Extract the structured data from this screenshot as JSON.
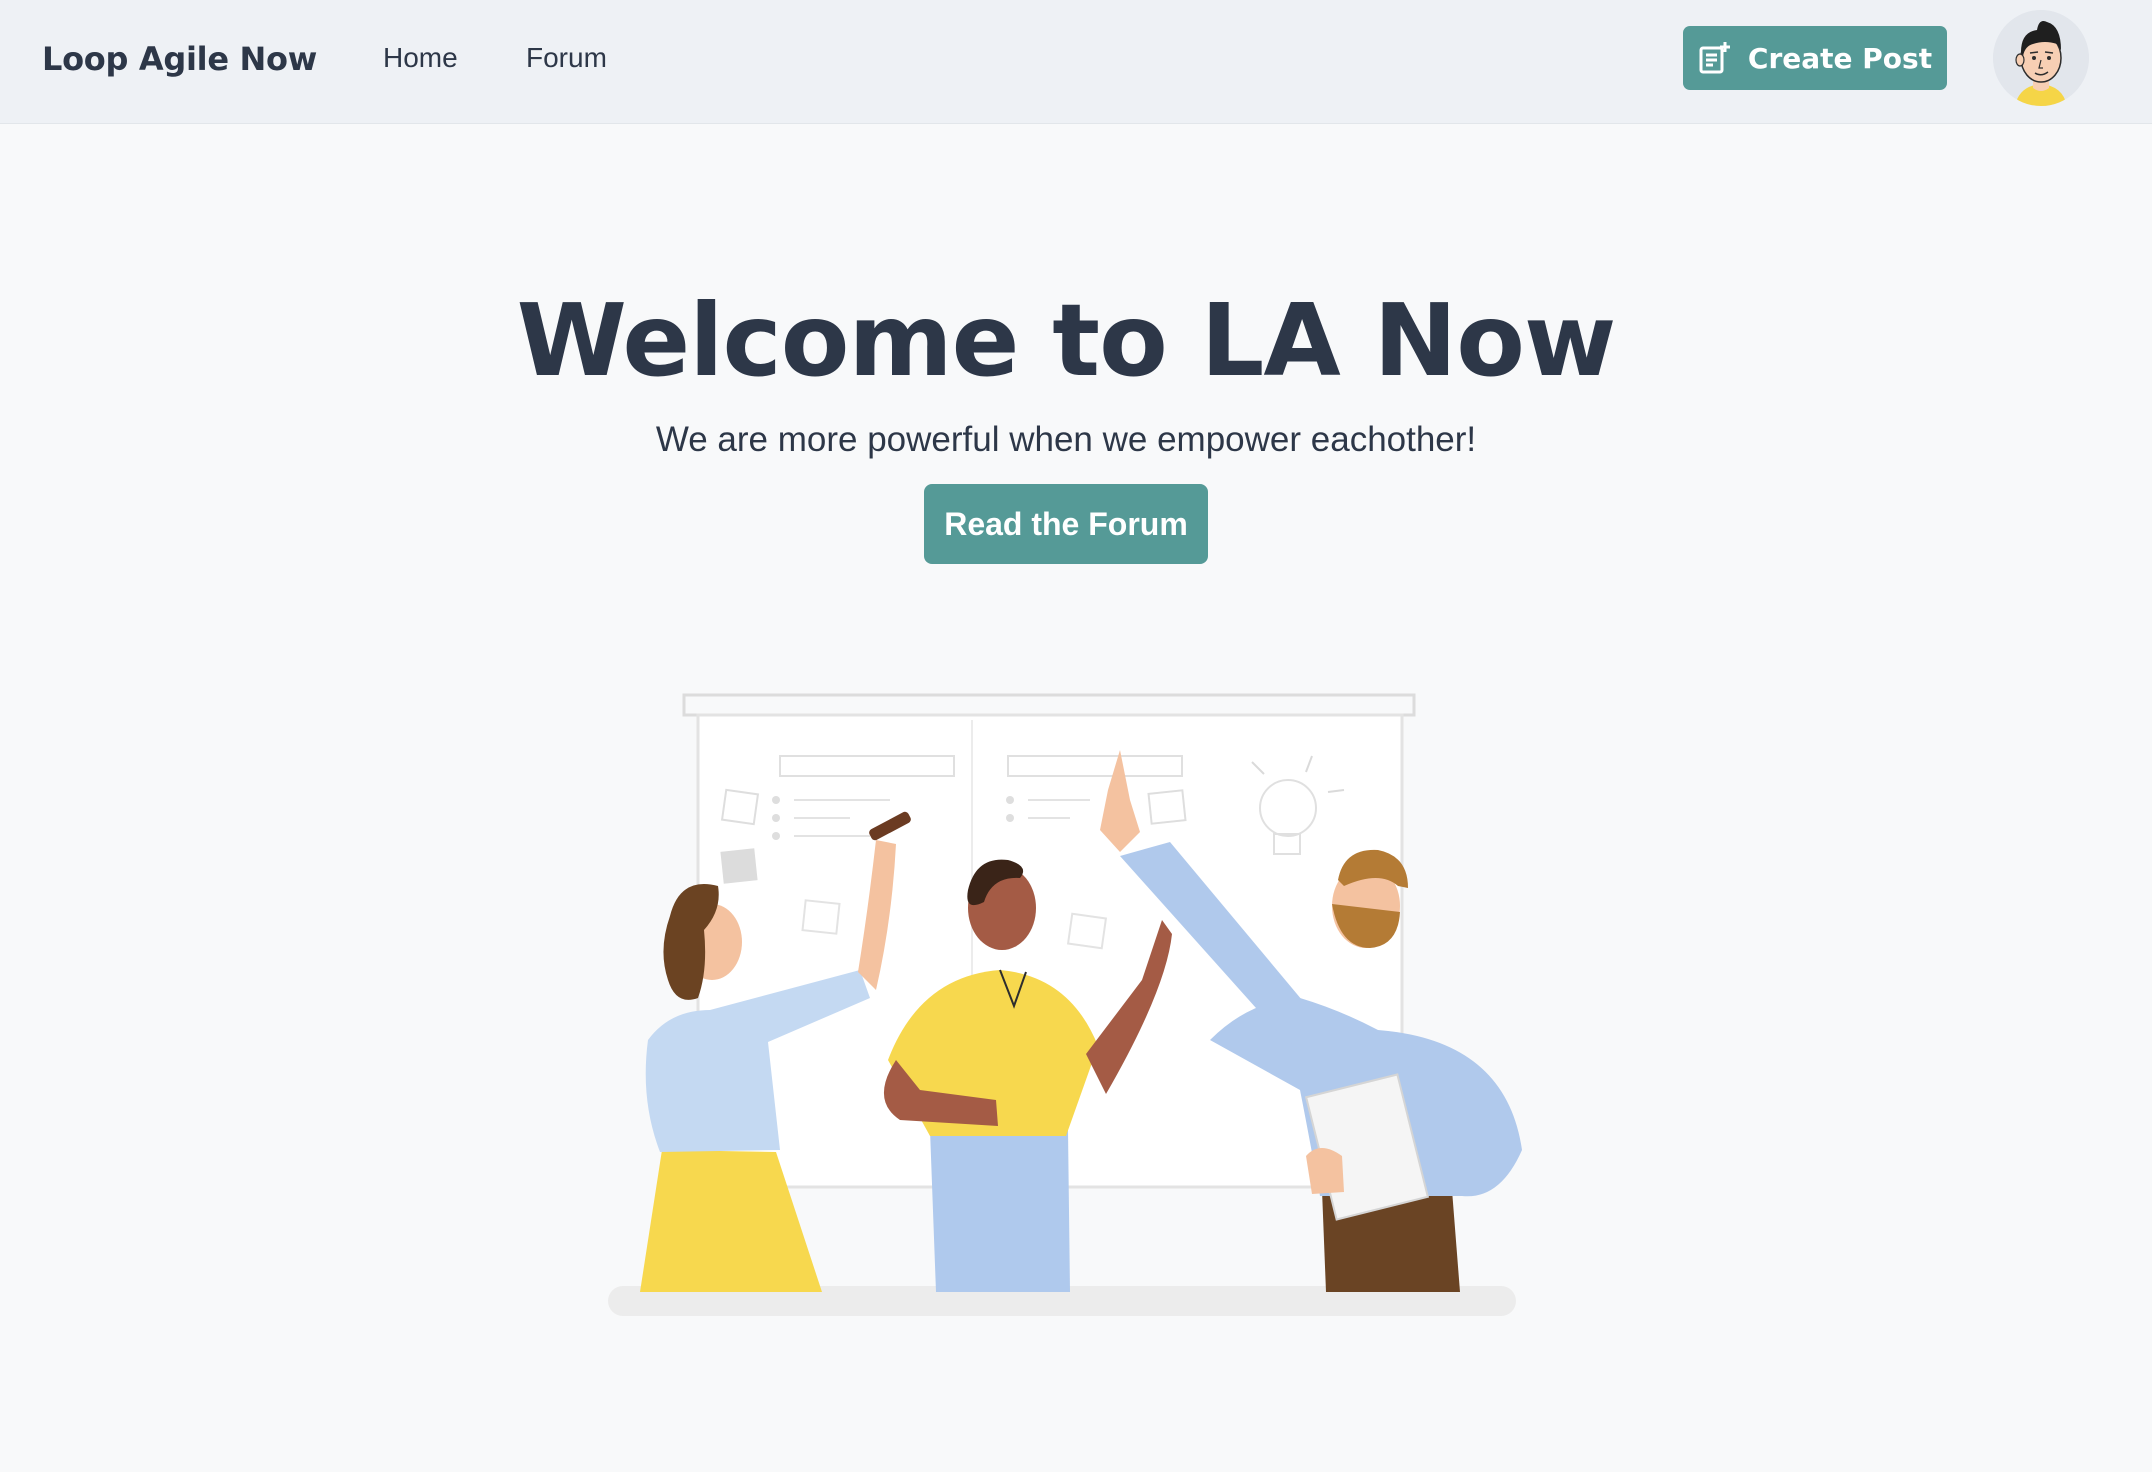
{
  "navbar": {
    "brand": "Loop Agile Now",
    "links": [
      {
        "label": "Home"
      },
      {
        "label": "Forum"
      }
    ],
    "create_post_label": "Create Post",
    "create_post_icon": "document-plus-icon",
    "avatar_icon": "user-avatar"
  },
  "hero": {
    "title": "Welcome to LA Now",
    "subtitle": "We are more powerful when we empower eachother!",
    "cta_label": "Read the Forum",
    "illustration": "team-collaboration-illustration"
  },
  "colors": {
    "accent": "#559a97",
    "navbar_bg": "#eef1f5",
    "page_bg": "#f8f9fa",
    "text": "#2d3748"
  }
}
